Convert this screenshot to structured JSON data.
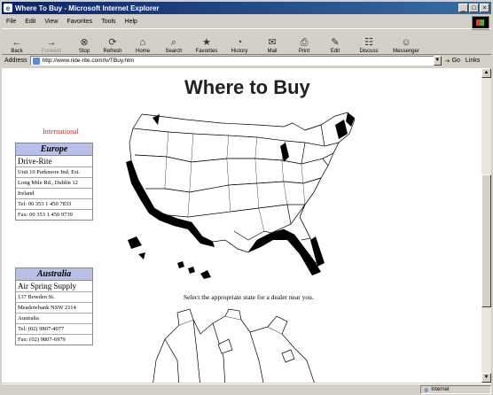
{
  "window": {
    "title": "Where To Buy - Microsoft Internet Explorer",
    "controls": [
      "_",
      "□",
      "×"
    ]
  },
  "menu": [
    "File",
    "Edit",
    "View",
    "Favorites",
    "Tools",
    "Help"
  ],
  "toolbar": [
    {
      "label": "Back",
      "icon": "←",
      "disabled": false
    },
    {
      "label": "Forward",
      "icon": "→",
      "disabled": true
    },
    {
      "label": "Stop",
      "icon": "⊗",
      "disabled": false
    },
    {
      "label": "Refresh",
      "icon": "⟳",
      "disabled": false
    },
    {
      "label": "Home",
      "icon": "⌂",
      "disabled": false
    },
    {
      "label": "Search",
      "icon": "⌕",
      "disabled": false
    },
    {
      "label": "Favorites",
      "icon": "★",
      "disabled": false
    },
    {
      "label": "History",
      "icon": "◔",
      "disabled": false
    },
    {
      "label": "Mail",
      "icon": "✉",
      "disabled": false
    },
    {
      "label": "Print",
      "icon": "⎙",
      "disabled": false
    },
    {
      "label": "Edit",
      "icon": "✎",
      "disabled": false
    },
    {
      "label": "Discuss",
      "icon": "☷",
      "disabled": false
    },
    {
      "label": "Messenger",
      "icon": "☺",
      "disabled": false
    }
  ],
  "address": {
    "label": "Address",
    "url": "http://www.ride-rite.com/lv/TBuy.htm",
    "go_label": "Go",
    "links_label": "Links"
  },
  "page": {
    "heading": "Where to Buy",
    "international_label": "International",
    "caption": "Select the appropriate state for a dealer near you."
  },
  "dealers": [
    {
      "region": "Europe",
      "name": "Drive-Rite",
      "lines": [
        "Unit 10 Parkmore Ind. Est.",
        "Long Mile Rd., Dublin 12",
        "Ireland",
        "Tel: 00 353 1 450 7833",
        "Fax: 00 353 1 450 9739"
      ]
    },
    {
      "region": "Australia",
      "name": "Air Spring Supply",
      "lines": [
        "137 Bowden St.",
        "Meadowbank NSW 2114",
        "Australia",
        "Tel: (02) 9807-4077",
        "Fax: (02) 9807-6979"
      ]
    }
  ],
  "status": {
    "text": "",
    "zone": "Internet"
  },
  "colors": {
    "titlebar": "#0a246a",
    "chrome": "#d4d0c8",
    "dealer_header": "#b9c0e8",
    "international": "#e02020"
  }
}
